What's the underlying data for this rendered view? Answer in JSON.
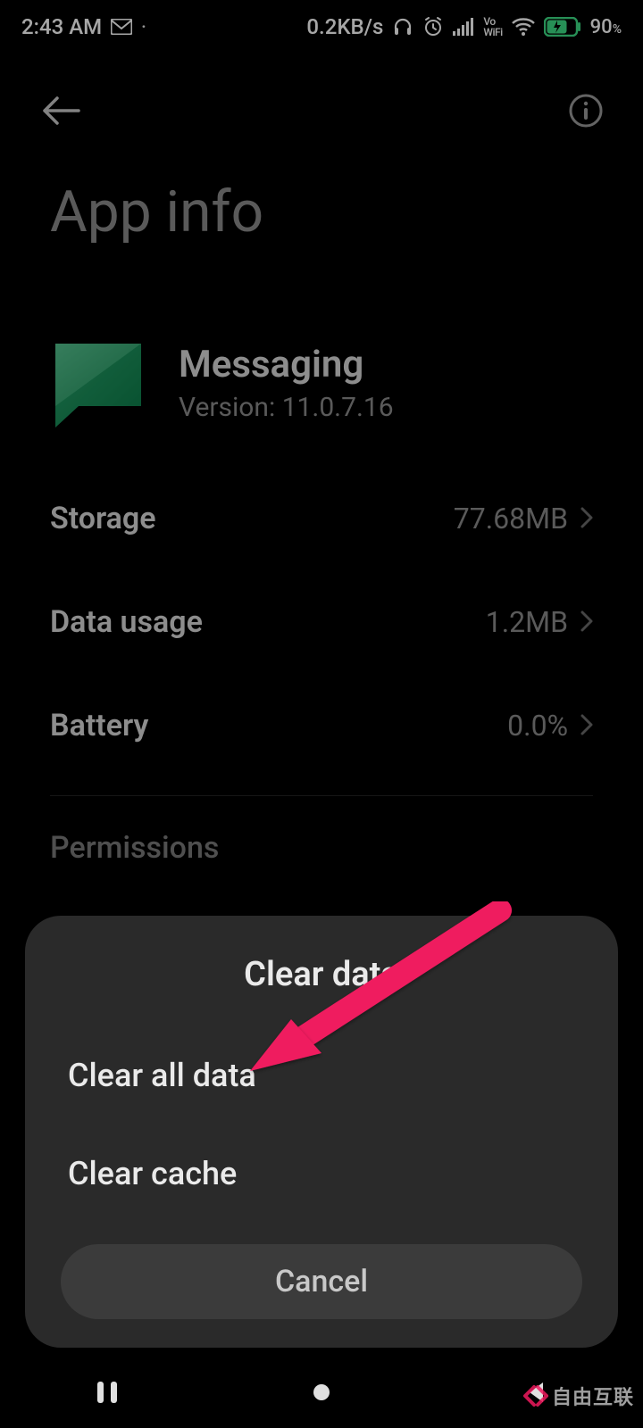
{
  "status": {
    "time": "2:43 AM",
    "mail_icon": "M",
    "net_speed": "0.2KB/s",
    "vowifi_top": "Vo",
    "vowifi_bot": "WiFi",
    "battery_pct": "90",
    "battery_pct_suffix": "%"
  },
  "page": {
    "title": "App info"
  },
  "app": {
    "name": "Messaging",
    "version": "Version: 11.0.7.16"
  },
  "rows": {
    "storage_label": "Storage",
    "storage_value": "77.68MB",
    "data_label": "Data usage",
    "data_value": "1.2MB",
    "battery_label": "Battery",
    "battery_value": "0.0%",
    "permissions_label": "Permissions"
  },
  "dialog": {
    "title": "Clear data",
    "clear_all": "Clear all data",
    "clear_cache": "Clear cache",
    "cancel": "Cancel"
  },
  "watermark": "自由互联"
}
